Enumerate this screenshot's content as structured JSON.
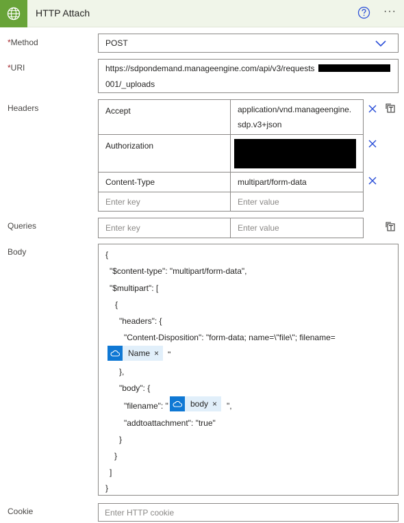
{
  "header": {
    "title": "HTTP Attach"
  },
  "method": {
    "label": "Method",
    "required_mark": "*",
    "value": "POST"
  },
  "uri": {
    "label": "URI",
    "required_mark": "*",
    "line1": "https://sdpondemand.manageengine.com/api/v3/requests",
    "line2": "001/_uploads"
  },
  "headers": {
    "label": "Headers",
    "rows": [
      {
        "key": "Accept",
        "value_line1": "application/vnd.manageengine.",
        "value_line2": "sdp.v3+json"
      },
      {
        "key": "Authorization",
        "value_line1": "",
        "value_line2": ""
      },
      {
        "key": "Content-Type",
        "value_line1": "multipart/form-data",
        "value_line2": ""
      }
    ],
    "key_placeholder": "Enter key",
    "value_placeholder": "Enter value"
  },
  "queries": {
    "label": "Queries",
    "key_placeholder": "Enter key",
    "value_placeholder": "Enter value"
  },
  "body": {
    "label": "Body",
    "lines": [
      "{",
      "\"$content-type\": \"multipart/form-data\",",
      "\"$multipart\": [",
      "{",
      "\"headers\": {",
      "\"Content-Disposition\": \"form-data; name=\\\"file\\\"; filename=",
      "\"",
      "},",
      "\"body\": {",
      "\"filename\": \"",
      "\",",
      "\"addtoattachment\": \"true\"",
      "}",
      "}",
      "]",
      "}"
    ],
    "tokens": [
      {
        "label": "Name",
        "close": "×"
      },
      {
        "label": "body",
        "close": "×"
      }
    ]
  },
  "cookie": {
    "label": "Cookie",
    "placeholder": "Enter HTTP cookie"
  },
  "colors": {
    "brand_green": "#68a338",
    "header_bg": "#f0f5e9",
    "accent_blue": "#0f78d4",
    "token_bg": "#e1effa",
    "required_red": "#a4262c"
  },
  "icons": {
    "app": "globe-icon",
    "help": "help-circle-icon",
    "more": "more-options-icon",
    "dropdown": "chevron-down-icon",
    "remove": "close-icon",
    "table_mode": "switch-to-text-icon",
    "dynamic_content": "onedrive-cloud-icon"
  }
}
